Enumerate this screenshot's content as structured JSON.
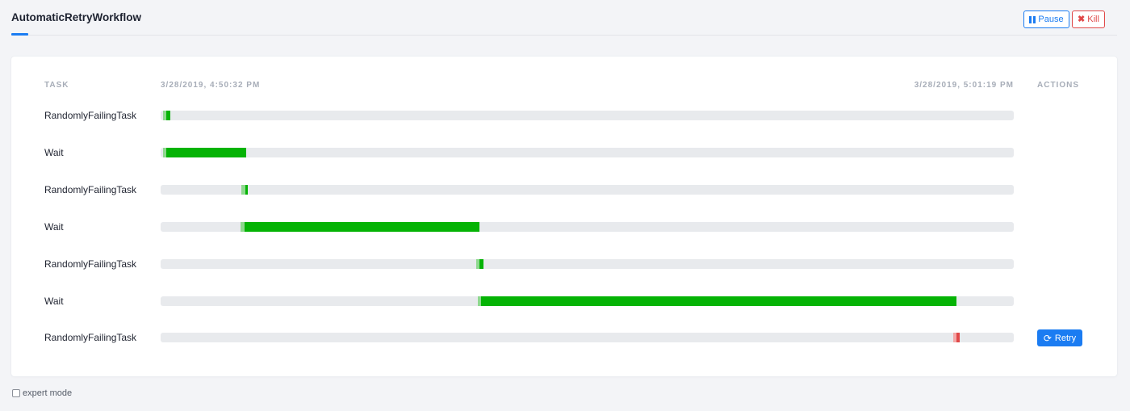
{
  "header": {
    "title": "AutomaticRetryWorkflow",
    "pause_label": "Pause",
    "kill_label": "Kill"
  },
  "table": {
    "col_task": "TASK",
    "start_time": "3/28/2019, 4:50:32 PM",
    "end_time": "3/28/2019, 5:01:19 PM",
    "col_actions": "ACTIONS",
    "rows": [
      {
        "name": "RandomlyFailingTask",
        "status": "success",
        "start": 0.003,
        "wait": 0.004,
        "end": 0.011,
        "action": ""
      },
      {
        "name": "Wait",
        "status": "success",
        "start": 0.003,
        "wait": 0.004,
        "end": 0.1,
        "action": ""
      },
      {
        "name": "RandomlyFailingTask",
        "status": "success",
        "start": 0.095,
        "wait": 0.004,
        "end": 0.101,
        "action": ""
      },
      {
        "name": "Wait",
        "status": "success",
        "start": 0.094,
        "wait": 0.004,
        "end": 0.374,
        "action": ""
      },
      {
        "name": "RandomlyFailingTask",
        "status": "success",
        "start": 0.37,
        "wait": 0.004,
        "end": 0.378,
        "action": ""
      },
      {
        "name": "Wait",
        "status": "success",
        "start": 0.372,
        "wait": 0.004,
        "end": 0.933,
        "action": ""
      },
      {
        "name": "RandomlyFailingTask",
        "status": "failed",
        "start": 0.929,
        "wait": 0.004,
        "end": 0.937,
        "action": "Retry"
      }
    ]
  },
  "colors": {
    "success": "#05b305",
    "success_wait": "#8ed88e",
    "failed": "#e04848",
    "failed_wait": "#f3a8a8",
    "accent": "#1b7cf2"
  },
  "footer": {
    "expert_mode_label": "expert mode"
  }
}
